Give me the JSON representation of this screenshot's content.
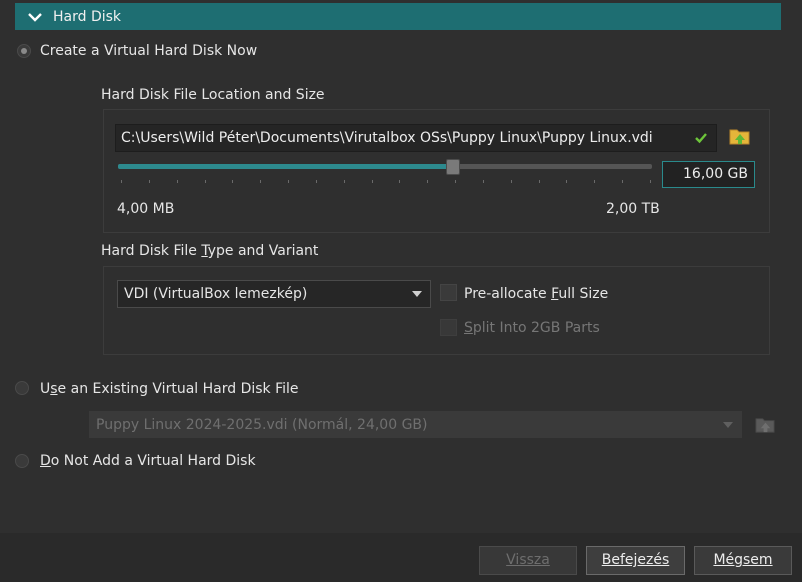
{
  "section": {
    "title": "Hard Disk"
  },
  "options": {
    "create_now": "Create a Virtual Hard Disk Now",
    "use_existing": "Use an Existing Virtual Hard Disk File",
    "do_not_add": "Do Not Add a Virtual Hard Disk"
  },
  "location": {
    "heading": "Hard Disk File Location and Size",
    "path": "C:\\Users\\Wild Péter\\Documents\\Virutalbox OSs\\Puppy Linux\\Puppy Linux.vdi",
    "size_value": "16,00 GB",
    "slider_fraction": 0.63,
    "min_label": "4,00 MB",
    "max_label": "2,00 TB"
  },
  "type": {
    "heading": "Hard Disk File Type and Variant",
    "selected": "VDI (VirtualBox lemezkép)",
    "preallocate": "Pre-allocate Full Size",
    "split": "Split Into 2GB Parts"
  },
  "existing": {
    "selected": "Puppy Linux 2024-2025.vdi (Normál, 24,00 GB)"
  },
  "buttons": {
    "back": "Vissza",
    "finish": "Befejezés",
    "cancel": "Mégsem"
  }
}
